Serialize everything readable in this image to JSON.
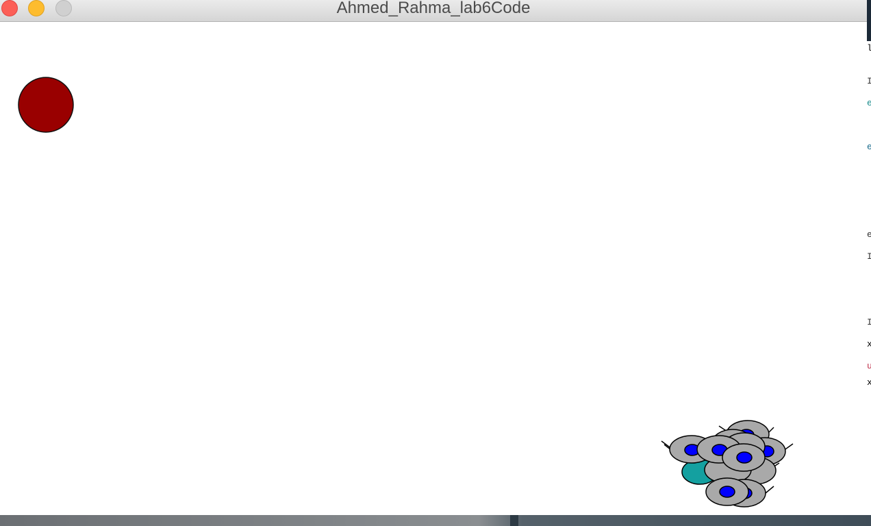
{
  "window": {
    "title": "Ahmed_Rahma_lab6Code"
  },
  "traffic_lights": [
    "close",
    "minimize",
    "zoom"
  ],
  "background_editor_chars": [
    "l",
    "I",
    "e",
    "e",
    "e",
    "I",
    "I",
    "x",
    "u",
    "x"
  ],
  "colors": {
    "ball": "#990000",
    "vehicle_body": "#a9a9a9",
    "vehicle_core": "#0000ff",
    "leader": "#14a0a0"
  }
}
